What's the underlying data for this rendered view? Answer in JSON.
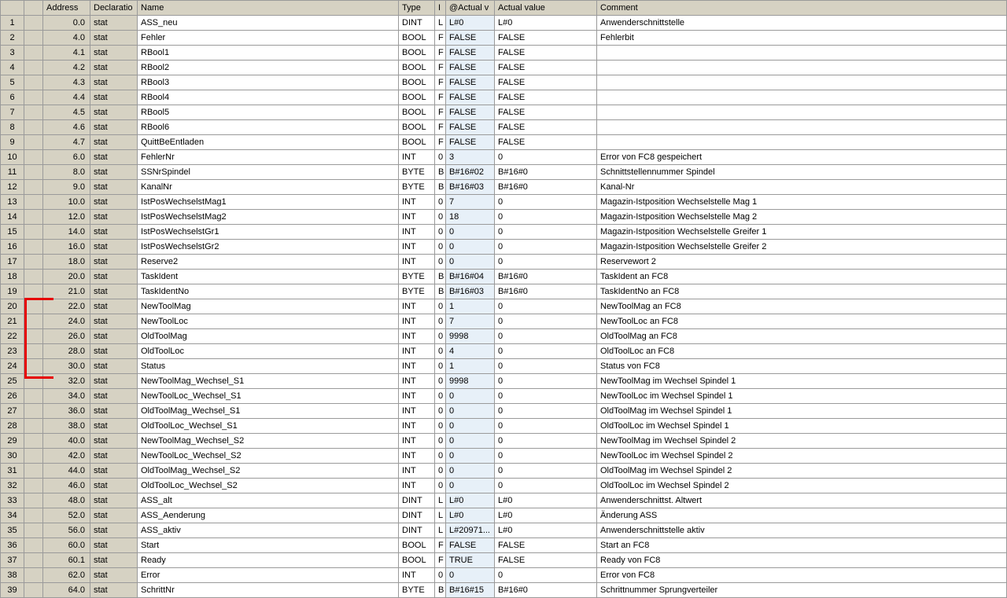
{
  "columns": [
    "",
    "",
    "Address",
    "Declaratio",
    "Name",
    "Type",
    "I",
    "@Actual v",
    "Actual value",
    "Comment"
  ],
  "rows": [
    {
      "n": "1",
      "a": "0.0",
      "d": "stat",
      "name": "ASS_neu",
      "t": "DINT",
      "i": "L",
      "at": "L#0",
      "av": "L#0",
      "c": "Anwenderschnittstelle"
    },
    {
      "n": "2",
      "a": "4.0",
      "d": "stat",
      "name": "Fehler",
      "t": "BOOL",
      "i": "F",
      "at": "FALSE",
      "av": "FALSE",
      "c": "Fehlerbit"
    },
    {
      "n": "3",
      "a": "4.1",
      "d": "stat",
      "name": "RBool1",
      "t": "BOOL",
      "i": "F",
      "at": "FALSE",
      "av": "FALSE",
      "c": ""
    },
    {
      "n": "4",
      "a": "4.2",
      "d": "stat",
      "name": "RBool2",
      "t": "BOOL",
      "i": "F",
      "at": "FALSE",
      "av": "FALSE",
      "c": ""
    },
    {
      "n": "5",
      "a": "4.3",
      "d": "stat",
      "name": "RBool3",
      "t": "BOOL",
      "i": "F",
      "at": "FALSE",
      "av": "FALSE",
      "c": ""
    },
    {
      "n": "6",
      "a": "4.4",
      "d": "stat",
      "name": "RBool4",
      "t": "BOOL",
      "i": "F",
      "at": "FALSE",
      "av": "FALSE",
      "c": ""
    },
    {
      "n": "7",
      "a": "4.5",
      "d": "stat",
      "name": "RBool5",
      "t": "BOOL",
      "i": "F",
      "at": "FALSE",
      "av": "FALSE",
      "c": ""
    },
    {
      "n": "8",
      "a": "4.6",
      "d": "stat",
      "name": "RBool6",
      "t": "BOOL",
      "i": "F",
      "at": "FALSE",
      "av": "FALSE",
      "c": ""
    },
    {
      "n": "9",
      "a": "4.7",
      "d": "stat",
      "name": "QuittBeEntladen",
      "t": "BOOL",
      "i": "F",
      "at": "FALSE",
      "av": "FALSE",
      "c": ""
    },
    {
      "n": "10",
      "a": "6.0",
      "d": "stat",
      "name": "FehlerNr",
      "t": "INT",
      "i": "0",
      "at": "3",
      "av": "0",
      "c": "Error von FC8 gespeichert"
    },
    {
      "n": "11",
      "a": "8.0",
      "d": "stat",
      "name": "SSNrSpindel",
      "t": "BYTE",
      "i": "B",
      "at": "B#16#02",
      "av": "B#16#0",
      "c": "Schnittstellennummer Spindel"
    },
    {
      "n": "12",
      "a": "9.0",
      "d": "stat",
      "name": "KanalNr",
      "t": "BYTE",
      "i": "B",
      "at": "B#16#03",
      "av": "B#16#0",
      "c": "Kanal-Nr"
    },
    {
      "n": "13",
      "a": "10.0",
      "d": "stat",
      "name": "IstPosWechselstMag1",
      "t": "INT",
      "i": "0",
      "at": "7",
      "av": "0",
      "c": "Magazin-Istposition Wechselstelle Mag 1"
    },
    {
      "n": "14",
      "a": "12.0",
      "d": "stat",
      "name": "IstPosWechselstMag2",
      "t": "INT",
      "i": "0",
      "at": "18",
      "av": "0",
      "c": "Magazin-Istposition Wechselstelle Mag 2"
    },
    {
      "n": "15",
      "a": "14.0",
      "d": "stat",
      "name": "IstPosWechselstGr1",
      "t": "INT",
      "i": "0",
      "at": "0",
      "av": "0",
      "c": "Magazin-Istposition Wechselstelle Greifer 1"
    },
    {
      "n": "16",
      "a": "16.0",
      "d": "stat",
      "name": "IstPosWechselstGr2",
      "t": "INT",
      "i": "0",
      "at": "0",
      "av": "0",
      "c": "Magazin-Istposition Wechselstelle Greifer 2"
    },
    {
      "n": "17",
      "a": "18.0",
      "d": "stat",
      "name": "Reserve2",
      "t": "INT",
      "i": "0",
      "at": "0",
      "av": "0",
      "c": "Reservewort 2"
    },
    {
      "n": "18",
      "a": "20.0",
      "d": "stat",
      "name": "TaskIdent",
      "t": "BYTE",
      "i": "B",
      "at": "B#16#04",
      "av": "B#16#0",
      "c": "TaskIdent an FC8"
    },
    {
      "n": "19",
      "a": "21.0",
      "d": "stat",
      "name": "TaskIdentNo",
      "t": "BYTE",
      "i": "B",
      "at": "B#16#03",
      "av": "B#16#0",
      "c": "TaskIdentNo an FC8"
    },
    {
      "n": "20",
      "a": "22.0",
      "d": "stat",
      "name": "NewToolMag",
      "t": "INT",
      "i": "0",
      "at": "1",
      "av": "0",
      "c": "NewToolMag an FC8"
    },
    {
      "n": "21",
      "a": "24.0",
      "d": "stat",
      "name": "NewToolLoc",
      "t": "INT",
      "i": "0",
      "at": "7",
      "av": "0",
      "c": "NewToolLoc an FC8"
    },
    {
      "n": "22",
      "a": "26.0",
      "d": "stat",
      "name": "OldToolMag",
      "t": "INT",
      "i": "0",
      "at": "9998",
      "av": "0",
      "c": "OldToolMag an FC8"
    },
    {
      "n": "23",
      "a": "28.0",
      "d": "stat",
      "name": "OldToolLoc",
      "t": "INT",
      "i": "0",
      "at": "4",
      "av": "0",
      "c": "OldToolLoc an FC8"
    },
    {
      "n": "24",
      "a": "30.0",
      "d": "stat",
      "name": "Status",
      "t": "INT",
      "i": "0",
      "at": "1",
      "av": "0",
      "c": "Status von FC8"
    },
    {
      "n": "25",
      "a": "32.0",
      "d": "stat",
      "name": "NewToolMag_Wechsel_S1",
      "t": "INT",
      "i": "0",
      "at": "9998",
      "av": "0",
      "c": "NewToolMag im Wechsel Spindel 1"
    },
    {
      "n": "26",
      "a": "34.0",
      "d": "stat",
      "name": "NewToolLoc_Wechsel_S1",
      "t": "INT",
      "i": "0",
      "at": "0",
      "av": "0",
      "c": "NewToolLoc im Wechsel Spindel 1"
    },
    {
      "n": "27",
      "a": "36.0",
      "d": "stat",
      "name": "OldToolMag_Wechsel_S1",
      "t": "INT",
      "i": "0",
      "at": "0",
      "av": "0",
      "c": "OldToolMag im Wechsel Spindel 1"
    },
    {
      "n": "28",
      "a": "38.0",
      "d": "stat",
      "name": "OldToolLoc_Wechsel_S1",
      "t": "INT",
      "i": "0",
      "at": "0",
      "av": "0",
      "c": "OldToolLoc im Wechsel Spindel 1"
    },
    {
      "n": "29",
      "a": "40.0",
      "d": "stat",
      "name": "NewToolMag_Wechsel_S2",
      "t": "INT",
      "i": "0",
      "at": "0",
      "av": "0",
      "c": "NewToolMag im Wechsel Spindel 2"
    },
    {
      "n": "30",
      "a": "42.0",
      "d": "stat",
      "name": "NewToolLoc_Wechsel_S2",
      "t": "INT",
      "i": "0",
      "at": "0",
      "av": "0",
      "c": "NewToolLoc im Wechsel Spindel 2"
    },
    {
      "n": "31",
      "a": "44.0",
      "d": "stat",
      "name": "OldToolMag_Wechsel_S2",
      "t": "INT",
      "i": "0",
      "at": "0",
      "av": "0",
      "c": "OldToolMag im Wechsel Spindel 2"
    },
    {
      "n": "32",
      "a": "46.0",
      "d": "stat",
      "name": "OldToolLoc_Wechsel_S2",
      "t": "INT",
      "i": "0",
      "at": "0",
      "av": "0",
      "c": "OldToolLoc im Wechsel Spindel 2"
    },
    {
      "n": "33",
      "a": "48.0",
      "d": "stat",
      "name": "ASS_alt",
      "t": "DINT",
      "i": "L",
      "at": "L#0",
      "av": "L#0",
      "c": "Anwenderschnittst. Altwert"
    },
    {
      "n": "34",
      "a": "52.0",
      "d": "stat",
      "name": "ASS_Aenderung",
      "t": "DINT",
      "i": "L",
      "at": "L#0",
      "av": "L#0",
      "c": "Änderung ASS"
    },
    {
      "n": "35",
      "a": "56.0",
      "d": "stat",
      "name": "ASS_aktiv",
      "t": "DINT",
      "i": "L",
      "at": "L#20971...",
      "av": "L#0",
      "c": "Anwenderschnittstelle aktiv"
    },
    {
      "n": "36",
      "a": "60.0",
      "d": "stat",
      "name": "Start",
      "t": "BOOL",
      "i": "F",
      "at": "FALSE",
      "av": "FALSE",
      "c": "Start an FC8"
    },
    {
      "n": "37",
      "a": "60.1",
      "d": "stat",
      "name": "Ready",
      "t": "BOOL",
      "i": "F",
      "at": "TRUE",
      "av": "FALSE",
      "c": "Ready von FC8"
    },
    {
      "n": "38",
      "a": "62.0",
      "d": "stat",
      "name": "Error",
      "t": "INT",
      "i": "0",
      "at": "0",
      "av": "0",
      "c": "Error von FC8"
    },
    {
      "n": "39",
      "a": "64.0",
      "d": "stat",
      "name": "SchrittNr",
      "t": "BYTE",
      "i": "B",
      "at": "B#16#15",
      "av": "B#16#0",
      "c": "Schrittnummer Sprungverteiler"
    }
  ],
  "annotation": {
    "top_row": 20,
    "bottom_row": 25
  }
}
